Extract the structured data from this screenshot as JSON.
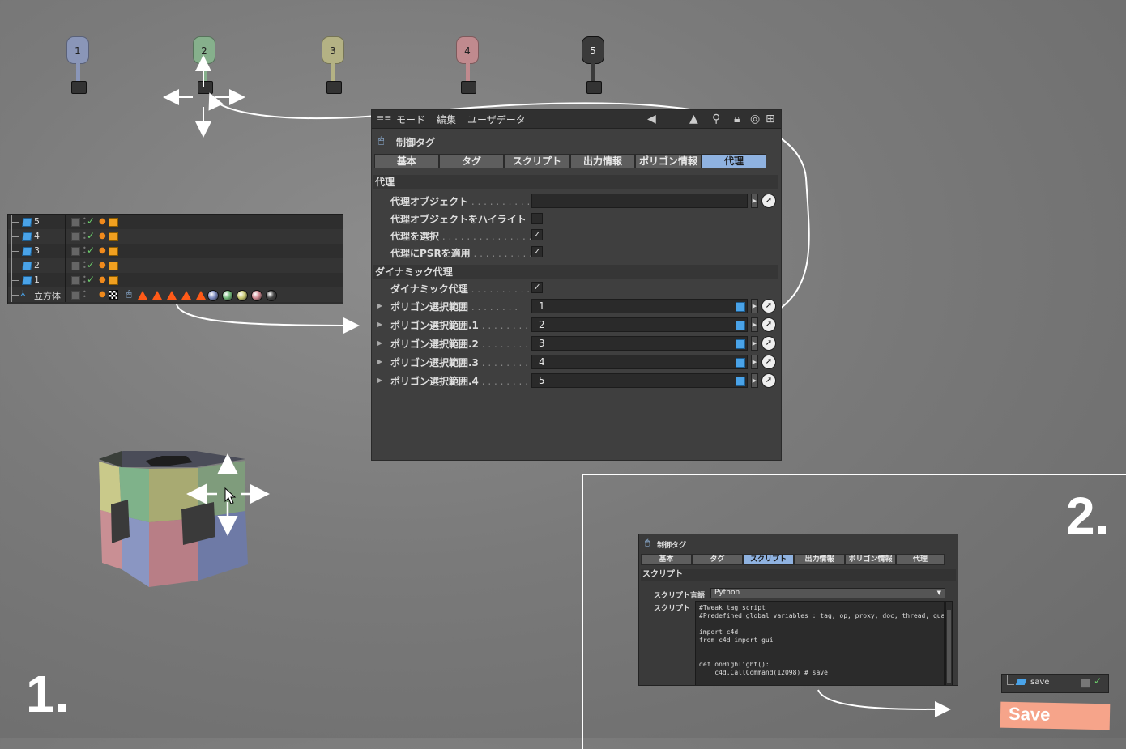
{
  "pins": [
    {
      "label": "1",
      "color": "#8a96b8"
    },
    {
      "label": "2",
      "color": "#86b08c"
    },
    {
      "label": "3",
      "color": "#b4b284"
    },
    {
      "label": "4",
      "color": "#c08a8e"
    },
    {
      "label": "5",
      "color": "#3a3a3a"
    }
  ],
  "object_manager": {
    "rows": [
      {
        "name": "5"
      },
      {
        "name": "4"
      },
      {
        "name": "3"
      },
      {
        "name": "2"
      },
      {
        "name": "1"
      },
      {
        "name": "立方体"
      }
    ]
  },
  "attribute_manager": {
    "menu": {
      "mode": "モード",
      "edit": "編集",
      "userdata": "ユーザデータ"
    },
    "title": "制御タグ",
    "tabs": [
      "基本",
      "タグ",
      "スクリプト",
      "出力情報",
      "ポリゴン情報",
      "代理"
    ],
    "active_tab": "代理",
    "section_proxy": "代理",
    "props": {
      "proxy_object": "代理オブジェクト",
      "proxy_highlight": "代理オブジェクトをハイライト",
      "proxy_select": "代理を選択",
      "proxy_psr": "代理にPSRを適用",
      "dyn_proxy": "ダイナミック代理"
    },
    "section_dynamic": "ダイナミック代理",
    "selections": [
      {
        "label": "ポリゴン選択範囲",
        "value": "1"
      },
      {
        "label": "ポリゴン選択範囲.1",
        "value": "2"
      },
      {
        "label": "ポリゴン選択範囲.2",
        "value": "3"
      },
      {
        "label": "ポリゴン選択範囲.3",
        "value": "4"
      },
      {
        "label": "ポリゴン選択範囲.4",
        "value": "5"
      }
    ]
  },
  "step1": "1.",
  "step2": "2.",
  "panel2": {
    "title": "制御タグ",
    "tabs": [
      "基本",
      "タグ",
      "スクリプト",
      "出力情報",
      "ポリゴン情報",
      "代理"
    ],
    "active_tab": "スクリプト",
    "section": "スクリプト",
    "lang_label": "スクリプト言語",
    "lang_value": "Python",
    "script_label": "スクリプト",
    "code": "#Tweak tag script\n#Predefined global variables : tag, op, proxy, doc, thread, qualifier\n\nimport c4d\nfrom c4d import gui\n\n\ndef onHighlight():\n    c4d.CallCommand(12098) # save",
    "save_row_label": "save",
    "save_button": "Save"
  },
  "colors": {
    "active_tab": "#8fb2e0",
    "save": "#f6a48a"
  }
}
